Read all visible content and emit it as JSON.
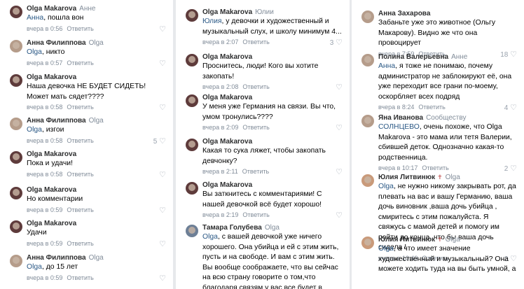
{
  "reply_label": "Ответить",
  "heart_glyph": "♡",
  "col1": [
    {
      "author": "Olga Makarova",
      "reply_to": "Анне",
      "mention": "Анна",
      "text": ", пошла вон",
      "time": "вчера в 0:56",
      "likes": ""
    },
    {
      "author": "Анна Филиппова",
      "reply_to": "Olga",
      "mention": "Olga",
      "text": ", никто",
      "time": "вчера в 0:57",
      "likes": ""
    },
    {
      "author": "Olga Makarova",
      "reply_to": "",
      "mention": "",
      "text": "Наша девочка НЕ БУДЕТ СИДЕТЬ! Может мать сядет????",
      "time": "вчера в 0:58",
      "likes": ""
    },
    {
      "author": "Анна Филиппова",
      "reply_to": "Olga",
      "mention": "Olga",
      "text": ", изгои",
      "time": "вчера в 0:58",
      "likes": "5"
    },
    {
      "author": "Olga Makarova",
      "reply_to": "",
      "mention": "",
      "text": "Пока и удачи!",
      "time": "вчера в 0:58",
      "likes": ""
    },
    {
      "author": "Olga Makarova",
      "reply_to": "",
      "mention": "",
      "text": "Но комментарии",
      "time": "вчера в 0:59",
      "likes": ""
    },
    {
      "author": "Olga Makarova",
      "reply_to": "",
      "mention": "",
      "text": "Удачи",
      "time": "вчера в 0:59",
      "likes": ""
    },
    {
      "author": "Анна Филиппова",
      "reply_to": "Olga",
      "mention": "Olga",
      "text": ", до 15 лет",
      "time": "вчера в 0:59",
      "likes": ""
    }
  ],
  "col2": [
    {
      "author": "Olga Makarova",
      "reply_to": "Юлии",
      "mention": "Юлия",
      "text": ", у девочки и художественный и музыкальный слух, и школу минимум 4...",
      "time": "вчера в 2:07",
      "likes": "3"
    },
    {
      "author": "Olga Makarova",
      "reply_to": "",
      "mention": "",
      "text": "Проснитесь, люди! Кого вы хотите закопать!",
      "time": "вчера в 2:08",
      "likes": ""
    },
    {
      "author": "Olga Makarova",
      "reply_to": "",
      "mention": "",
      "text": "У меня уже Германия на связи. Вы что, умом тронулись????",
      "time": "вчера в 2:09",
      "likes": ""
    },
    {
      "author": "Olga Makarova",
      "reply_to": "",
      "mention": "",
      "text": "Какая то сука ляжет, чтобы закопать девчонку?",
      "time": "вчера в 2:11",
      "likes": ""
    },
    {
      "author": "Olga Makarova",
      "reply_to": "",
      "mention": "",
      "text": "Вы заткнитесь с комментариями! С нашей девочкой всё будет хорошо!",
      "time": "вчера в 2:19",
      "likes": ""
    },
    {
      "author": "Тамара Голубева",
      "reply_to": "Olga",
      "mention": "Olga",
      "text": ", с вашей девочкой уже ничего хорошего. Она убийца и ей с этим жить, пусть и на свободе. И вам с этим жить. Вы вообще соображаете, что вы сейчас на всю страну говорите о том,что благодаря связям у вас все будет в",
      "time": "",
      "likes": ""
    }
  ],
  "col3": [
    {
      "author": "Анна Захарова",
      "reply_to": "",
      "mention": "",
      "text": "Забаньте уже это животное (Ольгу Макарову). Видно же что она провоцирует",
      "time": "вчера в 7:59",
      "likes": "18"
    },
    {
      "author": "Полина Валерьевна",
      "reply_to": "Анне",
      "mention": "Анна",
      "text": ", я тоже не понимаю, почему администратор не заблокируют её, она уже переходит все грани по-моему, оскорбляет всех подряд",
      "time": "вчера в 8:24",
      "likes": "4"
    },
    {
      "author": "Яна Иванова",
      "reply_to": "Сообществу",
      "mention": "СОЛНЦЕВО",
      "text": ", очень похоже, что Olga Makarova - это мама или тетя Валерии, сбившей деток. Однозначно какая-то родственница.",
      "time": "вчера в 10:17",
      "likes": "2"
    },
    {
      "author": "Юлия Литвинюк",
      "reply_to": "Olga",
      "mention": "Olga",
      "text": ", не нужно никому закрывать рот, да плевать на вас и вашу Германию, ваша дочь виновник ,ваша дочь убийца , смиритесь с этим пожалуйста. Я свяжусь с мамой детей и помогу им пойти до конца ,что бы ваша дочь сидела  !",
      "time": "вчера в 10:40",
      "likes": "2"
    },
    {
      "author": "Юлия Литвинюк",
      "reply_to": "Olga",
      "mention": "Olga",
      "text": ", а что имеет значение художественный и музыкальный? Она можете ходить туда на вы быть умной, а",
      "time": "",
      "likes": ""
    }
  ]
}
